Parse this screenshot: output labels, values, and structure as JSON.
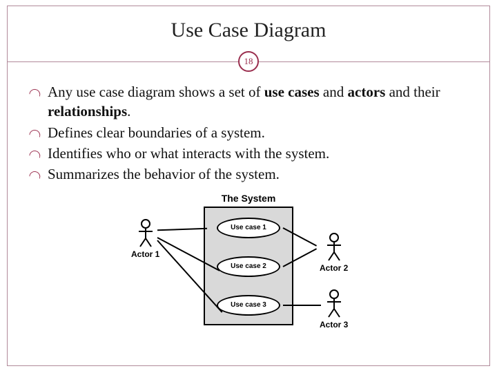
{
  "title": "Use Case Diagram",
  "page_number": "18",
  "bullets": [
    {
      "pre": "Any use case diagram shows a set of ",
      "b1": "use cases",
      "mid": " and ",
      "b2": "actors",
      "post1": " and their ",
      "b3": "relationships",
      "post2": "."
    },
    {
      "text": "Defines clear boundaries of a system."
    },
    {
      "text": "Identifies who or what interacts with the system."
    },
    {
      "text": "Summarizes the behavior of the system."
    }
  ],
  "diagram": {
    "system_title": "The System",
    "usecases": [
      "Use case 1",
      "Use case 2",
      "Use case 3"
    ],
    "actors": [
      "Actor 1",
      "Actor 2",
      "Actor 3"
    ]
  }
}
